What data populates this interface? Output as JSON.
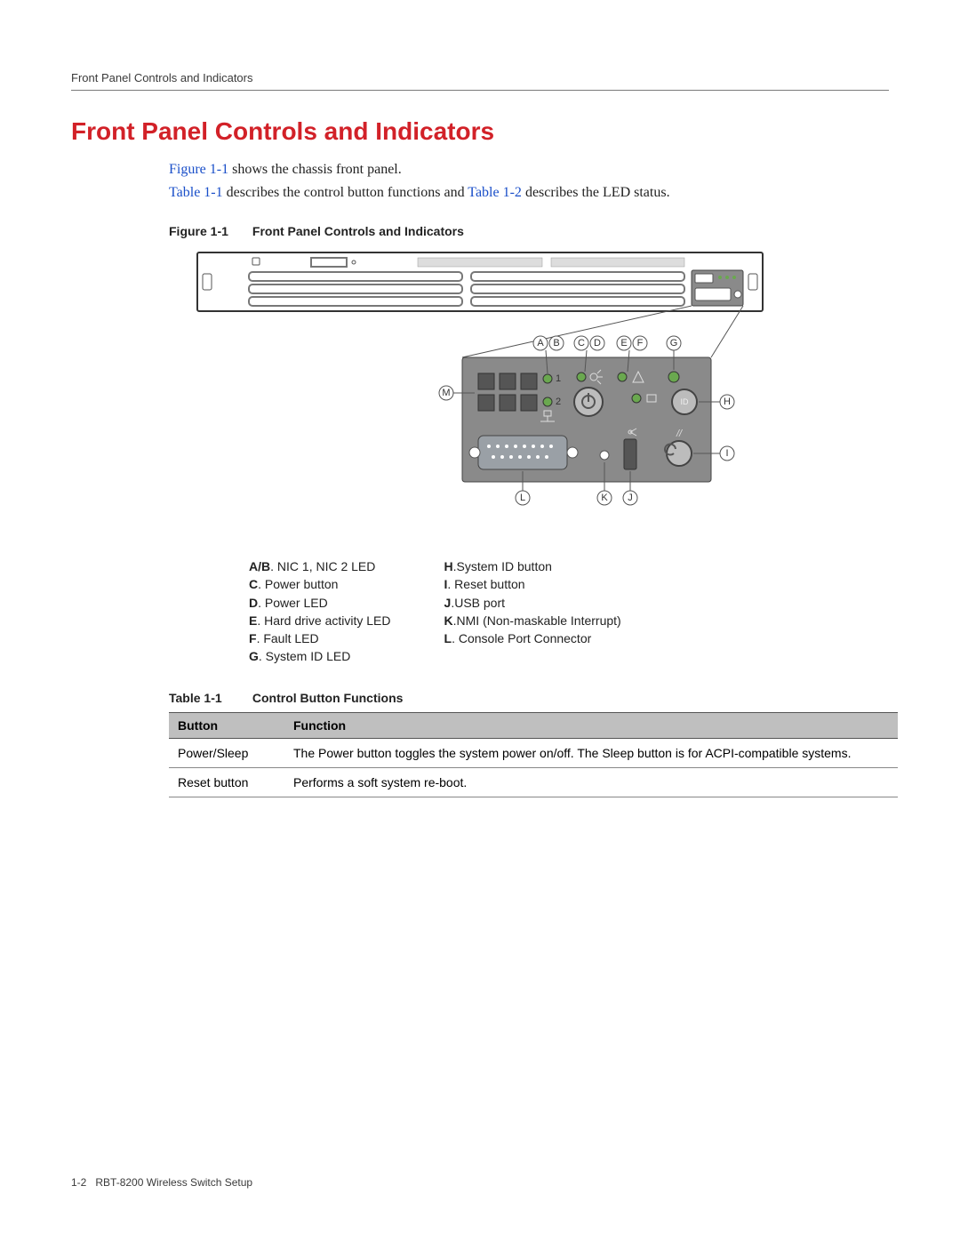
{
  "running_head": "Front Panel Controls and Indicators",
  "heading": "Front Panel Controls and Indicators",
  "para1_link": "Figure 1-1",
  "para1_rest": " shows the chassis front panel.",
  "para2_link1": "Table 1-1",
  "para2_mid": " describes the control button functions and ",
  "para2_link2": "Table 1-2",
  "para2_end": " describes the LED status.",
  "figure": {
    "num": "Figure 1-1",
    "title": "Front Panel Controls and Indicators"
  },
  "callouts": [
    "A",
    "B",
    "C",
    "D",
    "E",
    "F",
    "G",
    "H",
    "I",
    "J",
    "K",
    "L",
    "M"
  ],
  "legend_left": [
    {
      "k": "A/B",
      "v": ". NIC 1, NIC 2 LED"
    },
    {
      "k": "C",
      "v": ". Power button"
    },
    {
      "k": "D",
      "v": ". Power LED"
    },
    {
      "k": "E",
      "v": ". Hard drive activity LED"
    },
    {
      "k": "F",
      "v": ". Fault LED"
    },
    {
      "k": "G",
      "v": ". System ID LED"
    }
  ],
  "legend_right": [
    {
      "k": "H",
      "v": ".System ID button"
    },
    {
      "k": "I",
      "v": ". Reset button"
    },
    {
      "k": "J",
      "v": ".USB port"
    },
    {
      "k": "K",
      "v": ".NMI (Non-maskable Interrupt)"
    },
    {
      "k": "L",
      "v": ". Console Port Connector"
    }
  ],
  "table": {
    "num": "Table 1-1",
    "title": "Control Button Functions",
    "headers": [
      "Button",
      "Function"
    ],
    "rows": [
      {
        "button": "Power/Sleep",
        "func": "The Power button toggles the system power on/off. The Sleep button is for ACPI-compatible systems."
      },
      {
        "button": "Reset button",
        "func": "Performs a soft system re-boot."
      }
    ]
  },
  "footer_page": "1-2",
  "footer_title": "RBT-8200 Wireless Switch Setup"
}
